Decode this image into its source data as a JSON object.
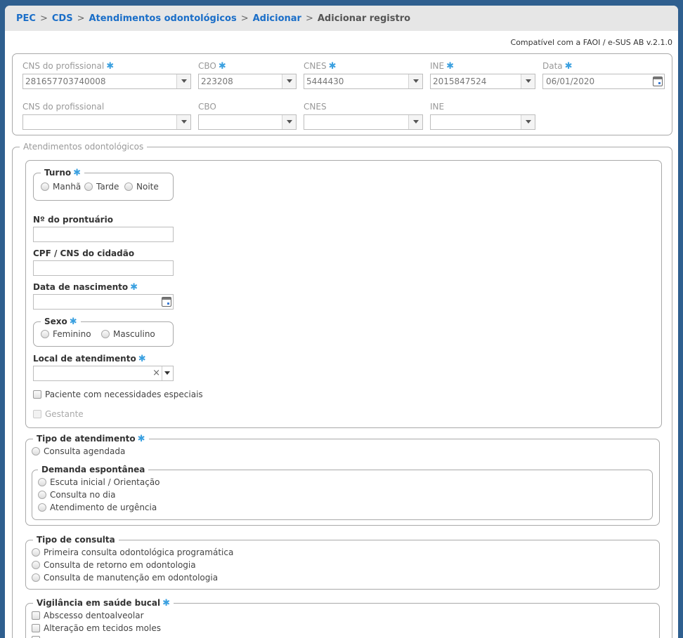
{
  "breadcrumb": {
    "items": [
      "PEC",
      "CDS",
      "Atendimentos odontológicos",
      "Adicionar"
    ],
    "current": "Adicionar registro",
    "separator": ">"
  },
  "compat_note": "Compatível com a FAOI / e-SUS AB v.2.1.0",
  "required_mark": "✱",
  "professional": {
    "row1": {
      "cns_label": "CNS do profissional",
      "cns_value": "281657703740008",
      "cbo_label": "CBO",
      "cbo_value": "223208",
      "cnes_label": "CNES",
      "cnes_value": "5444430",
      "ine_label": "INE",
      "ine_value": "2015847524",
      "date_label": "Data",
      "date_value": "06/01/2020"
    },
    "row2": {
      "cns_label": "CNS do profissional",
      "cns_value": "",
      "cbo_label": "CBO",
      "cbo_value": "",
      "cnes_label": "CNES",
      "cnes_value": "",
      "ine_label": "INE",
      "ine_value": ""
    }
  },
  "atendimentos": {
    "legend": "Atendimentos odontológicos",
    "turno": {
      "legend": "Turno",
      "options": [
        "Manhã",
        "Tarde",
        "Noite"
      ]
    },
    "prontuario": {
      "label": "Nº do prontuário",
      "value": ""
    },
    "cpf_cns": {
      "label": "CPF / CNS do cidadão",
      "value": ""
    },
    "nascimento": {
      "label": "Data de nascimento",
      "value": ""
    },
    "sexo": {
      "legend": "Sexo",
      "options": [
        "Feminino",
        "Masculino"
      ]
    },
    "local": {
      "label": "Local de atendimento",
      "value": "",
      "clear": "×"
    },
    "necessidades": "Paciente com necessidades especiais",
    "gestante": "Gestante"
  },
  "tipo_atendimento": {
    "legend": "Tipo de atendimento",
    "consulta_agendada": "Consulta agendada",
    "demanda": {
      "legend": "Demanda espontânea",
      "options": [
        "Escuta inicial / Orientação",
        "Consulta no dia",
        "Atendimento de urgência"
      ]
    }
  },
  "tipo_consulta": {
    "legend": "Tipo de consulta",
    "options": [
      "Primeira consulta odontológica programática",
      "Consulta de retorno em odontologia",
      "Consulta de manutenção em odontologia"
    ]
  },
  "vigilancia": {
    "legend": "Vigilância em saúde bucal",
    "options": [
      "Abscesso dentoalveolar",
      "Alteração em tecidos moles"
    ]
  }
}
